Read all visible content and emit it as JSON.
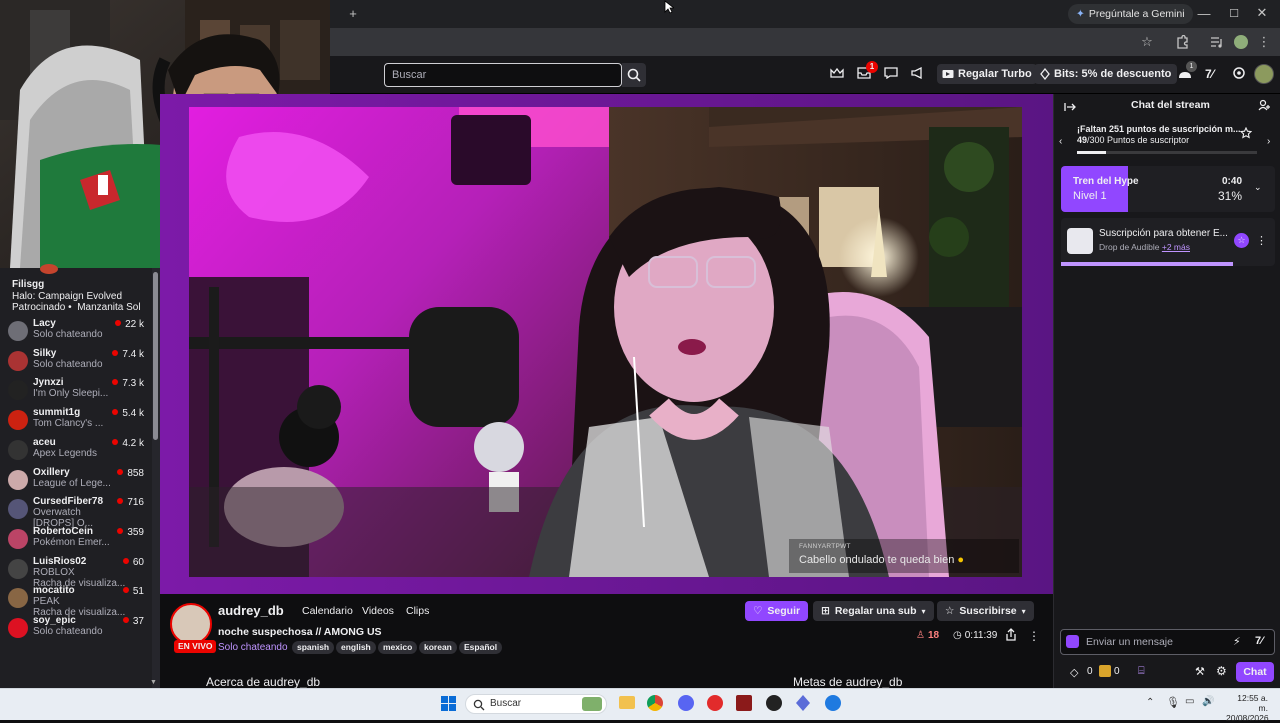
{
  "browser": {
    "new_tab": "+",
    "gemini_label": "Pregúntale a Gemini",
    "window_controls": [
      "—",
      "☐",
      "✕"
    ]
  },
  "twitch_nav": {
    "search_placeholder": "Buscar",
    "notif_badge": "1",
    "gift_turbo": "Regalar Turbo",
    "bits_offer": "Bits: 5% de descuento",
    "bits_badge": "1"
  },
  "sidebar": {
    "top_channel": {
      "name": "Filisgg",
      "game": "Halo: Campaign Evolved",
      "sponsor": "Patrocinado",
      "sponsor_brand": "Manzanita Sol"
    },
    "channels": [
      {
        "name": "Lacy",
        "game": "Solo chateando",
        "viewers": "22 k",
        "color": "#6e6e76"
      },
      {
        "name": "Silky",
        "game": "Solo chateando",
        "viewers": "7.4 k",
        "color": "#a33"
      },
      {
        "name": "Jynxzi",
        "game": "I'm Only Sleepi...",
        "viewers": "7.3 k",
        "color": "#222"
      },
      {
        "name": "summit1g",
        "game": "Tom Clancy's ...",
        "viewers": "5.4 k",
        "color": "#c21"
      },
      {
        "name": "aceu",
        "game": "Apex Legends",
        "viewers": "4.2 k",
        "color": "#333"
      },
      {
        "name": "Oxillery",
        "game": "League of Lege...",
        "viewers": "858",
        "color": "#caa"
      },
      {
        "name": "CursedFiber78",
        "game": "Overwatch",
        "extra": "[DROPS] O...",
        "viewers": "716",
        "color": "#557"
      },
      {
        "name": "RobertoCein",
        "game": "Pokémon Emer...",
        "viewers": "359",
        "color": "#b46"
      },
      {
        "name": "LuisRios02",
        "game": "ROBLOX",
        "extra": "Racha de visualiza...",
        "viewers": "60",
        "color": "#444"
      },
      {
        "name": "mocatito",
        "game": "PEAK",
        "extra": "Racha de visualiza...",
        "viewers": "51",
        "color": "#864"
      },
      {
        "name": "soy_epic",
        "game": "Solo chateando",
        "viewers": "37",
        "color": "#d12"
      }
    ]
  },
  "video_overlay": {
    "handle": "FANNYARTPWT",
    "message": "Cabello ondulado te queda bien"
  },
  "stream_info": {
    "channel": "audrey_db",
    "tabs": [
      "Calendario",
      "Videos",
      "Clips"
    ],
    "title": "noche suspechosa // AMONG US",
    "live_badge": "EN VIVO",
    "category": "Solo chateando",
    "tags": [
      "spanish",
      "english",
      "mexico",
      "korean",
      "Español"
    ],
    "follow": "Seguir",
    "gift_sub": "Regalar una sub",
    "subscribe": "Suscribirse",
    "viewers": "18",
    "uptime": "0:11:39",
    "about": "Acerca de audrey_db",
    "goals": "Metas de audrey_db"
  },
  "chat": {
    "title": "Chat del stream",
    "sub_goal_title": "¡Faltan 251 puntos de suscripción m...",
    "sub_goal_current": "49",
    "sub_goal_rest": "/300 Puntos de suscriptor",
    "sub_goal_progress": 0.16,
    "hype_title": "Tren del Hype",
    "hype_level": "Nivel 1",
    "hype_time": "0:40",
    "hype_percent": "31%",
    "drop_title": "Suscripción para obtener E...",
    "drop_sub": "Drop de Audible",
    "drop_more": "+2 más",
    "input_placeholder": "Enviar un mensaje",
    "bits_count": "0",
    "points_count": "0",
    "chat_button": "Chat"
  },
  "taskbar": {
    "search": "Buscar",
    "time": "12:55 a. m.",
    "date": "20/08/2026"
  },
  "colors": {
    "twitch_purple": "#9147ff",
    "live_red": "#eb0400"
  }
}
